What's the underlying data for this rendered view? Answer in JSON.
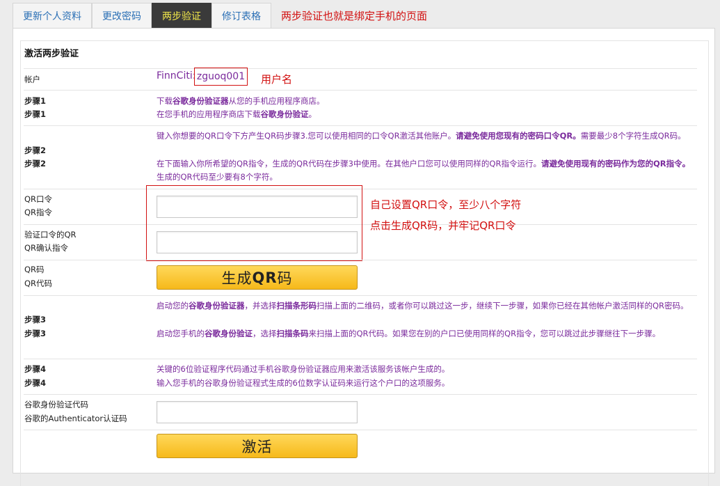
{
  "tabs": [
    {
      "label": "更新个人资料"
    },
    {
      "label": "更改密码"
    },
    {
      "label": "两步验证"
    },
    {
      "label": "修订表格"
    }
  ],
  "header_note": "两步验证也就是绑定手机的页面",
  "section_title": "激活两步验证",
  "account": {
    "label": "帐户",
    "prefix": "FinnCiti:",
    "username": "zguoq001",
    "note": "用户名"
  },
  "step1": {
    "label_a": "步骤1",
    "label_b": "步骤1",
    "line1_pre": "下载",
    "line1_bold": "谷歌身份验证器",
    "line1_post": "从您的手机应用程序商店。",
    "line2_pre": "在您手机的应用程序商店下载",
    "line2_bold": "谷歌身份验证",
    "line2_post": "。"
  },
  "step2": {
    "label_a": "步骤2",
    "label_b": "步骤2",
    "p1_pre": "键入你想要的QR口令下方产生QR码步骤3.您可以使用相同的口令QR激活其他账户。",
    "p1_bold": "请避免使用您现有的密码口令QR。",
    "p1_post": "需要最少8个字符生成QR码。",
    "p2_pre": "在下面输入你所希望的QR指令，生成的QR代码在步骤3中使用。在其他户口您可以使用同样的QR指令运行。",
    "p2_bold": "请避免使用现有的密码作为您的QR指令。",
    "p2_post": "生成的QR代码至少要有8个字符。"
  },
  "qr_pass": {
    "label_a": "QR口令",
    "label_b": "QR指令",
    "value": ""
  },
  "qr_confirm": {
    "label_a": "验证口令的QR",
    "label_b": "QR确认指令",
    "value": ""
  },
  "qr_notes": {
    "note1": "自己设置QR口令，至少八个字符",
    "note2": "点击生成QR码，并牢记QR口令"
  },
  "qr_code": {
    "label_a": "QR码",
    "label_b": "QR代码",
    "button_pre": "生成",
    "button_bold": "QR",
    "button_post": "码"
  },
  "step3": {
    "label_a": "步骤3",
    "label_b": "步骤3",
    "p1_pre": "启动您的",
    "p1_bold1": "谷歌身份验证器",
    "p1_mid": "，并选择",
    "p1_bold2": "扫描条形码",
    "p1_post": "扫描上面的二维码，或者你可以跳过这一步，继续下一步骤，如果你已经在其他帐户激活同样的QR密码。",
    "p2_pre": "启动您手机的",
    "p2_bold1": "谷歌身份验证",
    "p2_mid": "，选择",
    "p2_bold2": "扫描条码",
    "p2_post": "来扫描上面的QR代码。如果您在别的户口已使用同样的QR指令，您可以跳过此步骤继往下一步骤。"
  },
  "step4": {
    "label_a": "步骤4",
    "label_b": "步骤4",
    "line1": "关键的6位验证程序代码通过手机谷歌身份验证器应用来激活该服务该帐户生成的。",
    "line2": "输入您手机的谷歌身份验证程式生成的6位数字认证码来运行这个户口的这项服务。"
  },
  "auth_code": {
    "label_a": "谷歌身份验证代码",
    "label_b": "谷歌的Authenticator认证码",
    "value": ""
  },
  "activate_button": "激活",
  "colors": {
    "purple_text": "#7a2a9c",
    "annotation_red": "#d21010",
    "tab_active_bg": "#3a3a3a",
    "button_gold": "#f6b91a"
  }
}
